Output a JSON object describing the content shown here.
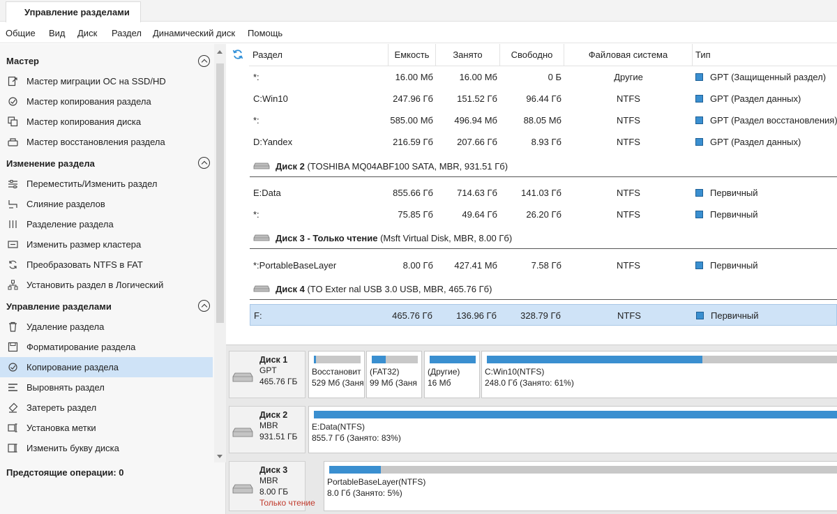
{
  "app": {
    "active_tab": "Управление разделами"
  },
  "menu": [
    "Общие",
    "Вид",
    "Диск",
    "Раздел",
    "Динамический диск",
    "Помощь"
  ],
  "left_pane": {
    "sections": [
      {
        "title": "Мастер",
        "items": [
          {
            "label": "Мастер миграции ОС на SSD/HD",
            "icon": "migrate-os-icon"
          },
          {
            "label": "Мастер копирования раздела",
            "icon": "copy-partition-wizard-icon"
          },
          {
            "label": "Мастер копирования диска",
            "icon": "copy-disk-icon"
          },
          {
            "label": "Мастер восстановления раздела",
            "icon": "partition-recovery-icon"
          }
        ]
      },
      {
        "title": "Изменение раздела",
        "items": [
          {
            "label": "Переместить/Изменить раздел",
            "icon": "move-resize-icon"
          },
          {
            "label": "Слияние разделов",
            "icon": "merge-icon"
          },
          {
            "label": "Разделение раздела",
            "icon": "split-icon"
          },
          {
            "label": "Изменить размер кластера",
            "icon": "cluster-size-icon"
          },
          {
            "label": "Преобразовать NTFS в FAT",
            "icon": "convert-icon"
          },
          {
            "label": "Установить раздел в Логический",
            "icon": "set-logical-icon"
          }
        ]
      },
      {
        "title": "Управление разделами",
        "items": [
          {
            "label": "Удаление раздела",
            "icon": "delete-icon"
          },
          {
            "label": "Форматирование раздела",
            "icon": "format-icon"
          },
          {
            "label": "Копирование раздела",
            "icon": "copy-partition-icon",
            "selected": true
          },
          {
            "label": "Выровнять раздел",
            "icon": "align-icon"
          },
          {
            "label": "Затереть раздел",
            "icon": "wipe-icon"
          },
          {
            "label": "Установка метки",
            "icon": "label-icon"
          },
          {
            "label": "Изменить букву диска",
            "icon": "drive-letter-icon"
          }
        ]
      }
    ],
    "pending": "Предстоящие операции: 0"
  },
  "table": {
    "headers": [
      "Раздел",
      "Емкость",
      "Занято",
      "Свободно",
      "Файловая система",
      "Тип"
    ],
    "rows": [
      {
        "kind": "part",
        "name": "*:",
        "cap": "16.00 Мб",
        "used": "16.00 Мб",
        "free": "0 Б",
        "fs": "Другие",
        "type": "GPT (Защищенный раздел)"
      },
      {
        "kind": "part",
        "name": "C:Win10",
        "cap": "247.96 Гб",
        "used": "151.52 Гб",
        "free": "96.44 Гб",
        "fs": "NTFS",
        "type": "GPT (Раздел данных)"
      },
      {
        "kind": "part",
        "name": "*:",
        "cap": "585.00 Мб",
        "used": "496.94 Мб",
        "free": "88.05 Мб",
        "fs": "NTFS",
        "type": "GPT (Раздел восстановления)"
      },
      {
        "kind": "part",
        "name": "D:Yandex",
        "cap": "216.59 Гб",
        "used": "207.66 Гб",
        "free": "8.93 Гб",
        "fs": "NTFS",
        "type": "GPT (Раздел данных)"
      },
      {
        "kind": "disk",
        "bold": "Диск 2",
        "rest": " (TOSHIBA MQ04ABF100 SATA, MBR, 931.51 Гб)"
      },
      {
        "kind": "part",
        "name": "E:Data",
        "cap": "855.66 Гб",
        "used": "714.63 Гб",
        "free": "141.03 Гб",
        "fs": "NTFS",
        "type": "Первичный"
      },
      {
        "kind": "part",
        "name": "*:",
        "cap": "75.85 Гб",
        "used": "49.64 Гб",
        "free": "26.20 Гб",
        "fs": "NTFS",
        "type": "Первичный"
      },
      {
        "kind": "disk",
        "bold": "Диск 3 - Только чтение",
        "rest": " (Msft Virtual Disk, MBR, 8.00 Гб)"
      },
      {
        "kind": "part",
        "name": "*:PortableBaseLayer",
        "cap": "8.00 Гб",
        "used": "427.41 Мб",
        "free": "7.58 Гб",
        "fs": "NTFS",
        "type": "Первичный"
      },
      {
        "kind": "disk",
        "bold": "Диск 4",
        "rest": " (TO Exter nal USB 3.0 USB, MBR, 465.76 Гб)"
      },
      {
        "kind": "part",
        "name": "F:",
        "cap": "465.76 Гб",
        "used": "136.96 Гб",
        "free": "328.79 Гб",
        "fs": "NTFS",
        "type": "Первичный",
        "selected": true
      }
    ]
  },
  "disk_map": [
    {
      "name": "Диск 1",
      "scheme": "GPT",
      "size": "465.76 ГБ",
      "readonly": "",
      "parts": [
        {
          "l1": "Восстановит",
          "l2": "529 Мб (Заня",
          "fill": 0.04
        },
        {
          "l1": "(FAT32)",
          "l2": "99 Мб (Заня",
          "fill": 0.3
        },
        {
          "l1": "(Другие)",
          "l2": "16 Мб",
          "fill": 1.0
        },
        {
          "l1": "C:Win10(NTFS)",
          "l2": "248.0 Гб (Занято: 61%)",
          "fill": 0.61
        }
      ]
    },
    {
      "name": "Диск 2",
      "scheme": "MBR",
      "size": "931.51 ГБ",
      "readonly": "",
      "parts": [
        {
          "l1": "E:Data(NTFS)",
          "l2": "855.7 Гб (Занято: 83%)",
          "fill": 1.0
        }
      ]
    },
    {
      "name": "Диск 3",
      "scheme": "MBR",
      "size": "8.00 ГБ",
      "readonly": "Только чтение",
      "parts": [
        {
          "l1": "PortableBaseLayer(NTFS)",
          "l2": "8.0 Гб (Занято: 5%)",
          "fill": 0.1
        }
      ]
    }
  ],
  "colors": {
    "accent": "#3a8fd0",
    "selection": "#cfe3f7",
    "readonly": "#c0392b"
  }
}
